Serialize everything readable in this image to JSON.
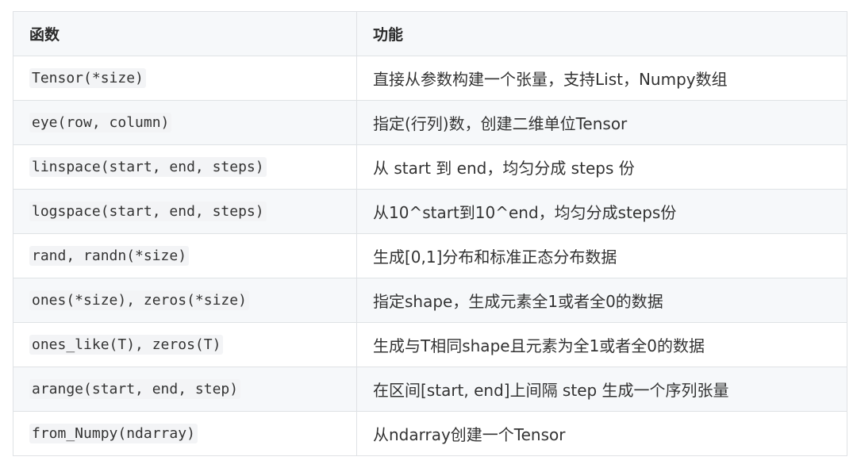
{
  "table": {
    "headers": [
      "函数",
      "功能"
    ],
    "rows": [
      {
        "func": "Tensor(*size)",
        "desc": "直接从参数构建一个张量，支持List，Numpy数组"
      },
      {
        "func": "eye(row, column)",
        "desc": "指定(行列)数，创建二维单位Tensor"
      },
      {
        "func": "linspace(start, end, steps)",
        "desc": "从 start 到 end，均匀分成 steps 份"
      },
      {
        "func": "logspace(start, end, steps)",
        "desc": "从10^start到10^end，均匀分成steps份"
      },
      {
        "func": "rand, randn(*size)",
        "desc": "生成[0,1]分布和标准正态分布数据"
      },
      {
        "func": "ones(*size), zeros(*size)",
        "desc": "指定shape，生成元素全1或者全0的数据"
      },
      {
        "func": "ones_like(T), zeros(T)",
        "desc": "生成与T相同shape且元素为全1或者全0的数据"
      },
      {
        "func": "arange(start, end, step)",
        "desc": "在区间[start, end]上间隔 step 生成一个序列张量"
      },
      {
        "func": "from_Numpy(ndarray)",
        "desc": "从ndarray创建一个Tensor"
      }
    ]
  }
}
